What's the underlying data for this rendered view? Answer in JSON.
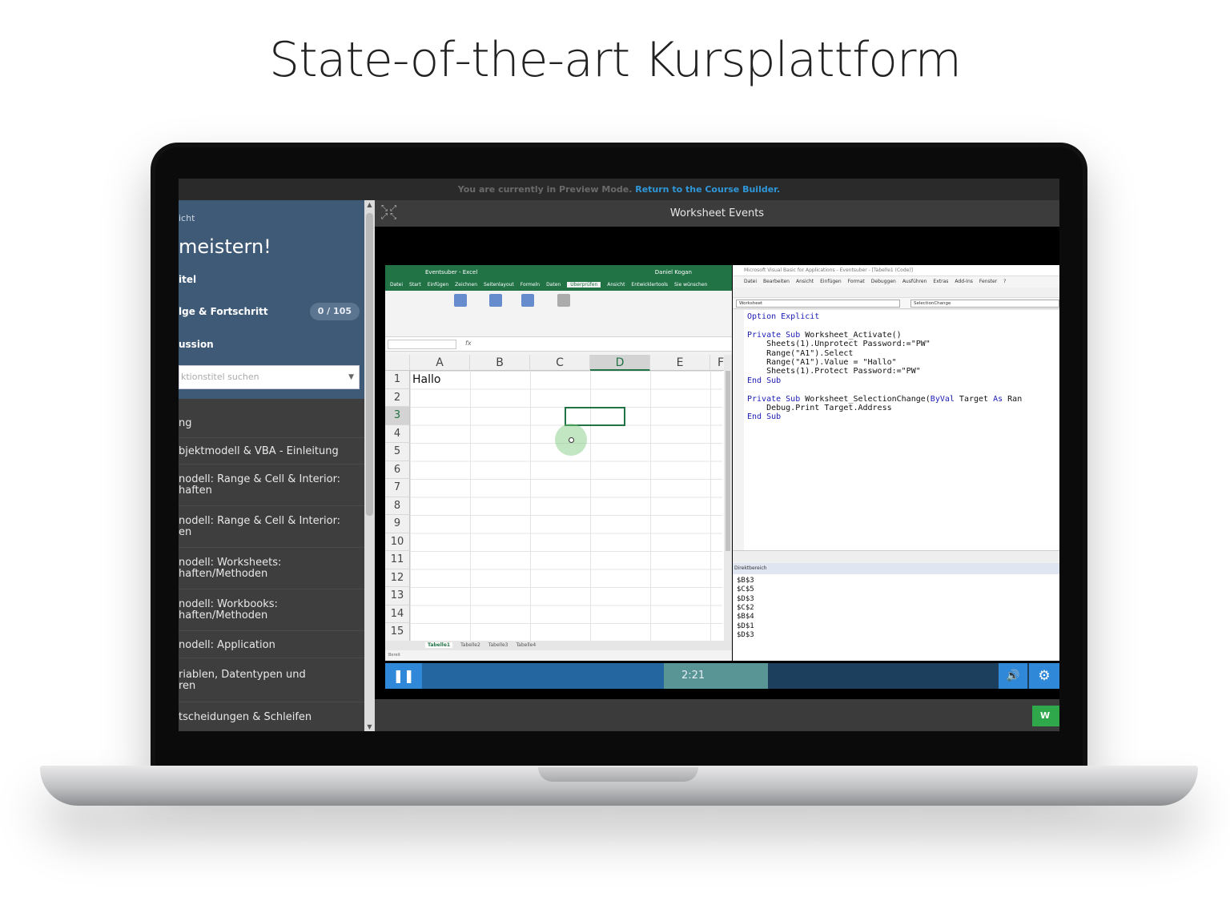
{
  "headline": "State-of-the-art Kursplattform",
  "preview_bar": {
    "text": "You are currently in Preview Mode.",
    "link": "Return to the Course Builder."
  },
  "sidebar": {
    "crumb": "icht",
    "course_title": "meistern!",
    "rows": [
      {
        "label": "itel"
      },
      {
        "label": "lge & Fortschritt",
        "badge": "0 / 105"
      },
      {
        "label": "ussion"
      }
    ],
    "search_placeholder": "ktionstitel suchen",
    "lessons": [
      "ng",
      "bjektmodell & VBA - Einleitung",
      "nodell: Range & Cell & Interior:\nhaften",
      "nodell: Range & Cell & Interior:\nen",
      "nodell: Worksheets:\nhaften/Methoden",
      "nodell: Workbooks:\nhaften/Methoden",
      "nodell: Application",
      "riablen, Datentypen und\nren",
      "tscheidungen & Schleifen"
    ]
  },
  "player": {
    "title": "Worksheet Events",
    "timecode": "2:21",
    "progress": 0.42,
    "buffered": 0.6,
    "complete_label": "W"
  },
  "excel": {
    "window_title": "Eventsuber - Excel",
    "user": "Daniel Kogan",
    "tabs": [
      "Datei",
      "Start",
      "Einfügen",
      "Zeichnen",
      "Seitenlayout",
      "Formeln",
      "Daten",
      "Überprüfen",
      "Ansicht",
      "Entwicklertools",
      "Sie wünschen"
    ],
    "active_tab": "Überprüfen",
    "name_box": "D3",
    "columns": [
      "A",
      "B",
      "C",
      "D",
      "E",
      "F"
    ],
    "selected_column": "D",
    "rows": [
      "1",
      "2",
      "3",
      "4",
      "5",
      "6",
      "7",
      "8",
      "9",
      "10",
      "11",
      "12",
      "13",
      "14",
      "15"
    ],
    "selected_row": "3",
    "cell_a1": "Hallo",
    "sheets": [
      "Tabelle1",
      "Tabelle2",
      "Tabelle3",
      "Tabelle4"
    ],
    "active_sheet": "Tabelle1",
    "status": "Bereit"
  },
  "vbe": {
    "window_title": "Microsoft Visual Basic for Applications - Eventsuber - [Tabelle1 (Code)]",
    "menu": [
      "Datei",
      "Bearbeiten",
      "Ansicht",
      "Einfügen",
      "Format",
      "Debuggen",
      "Ausführen",
      "Extras",
      "Add-Ins",
      "Fenster",
      "?"
    ],
    "object_combo": "Worksheet",
    "proc_combo": "SelectionChange",
    "code": [
      "Option Explicit",
      "",
      "Private Sub Worksheet_Activate()",
      "    Sheets(1).Unprotect Password:=\"PW\"",
      "    Range(\"A1\").Select",
      "    Range(\"A1\").Value = \"Hallo\"",
      "    Sheets(1).Protect Password:=\"PW\"",
      "End Sub",
      "",
      "Private Sub Worksheet_SelectionChange(ByVal Target As Ran",
      "    Debug.Print Target.Address",
      "End Sub"
    ],
    "immediate_title": "Direktbereich",
    "immediate": [
      "$B$3",
      "$C$5",
      "$D$3",
      "$C$2",
      "$B$4",
      "$D$1",
      "$D$3"
    ]
  },
  "colors": {
    "sidebar_header": "#3f5a77",
    "player_accent": "#2f88d8",
    "excel_green": "#217346",
    "complete_green": "#2ea84a"
  }
}
